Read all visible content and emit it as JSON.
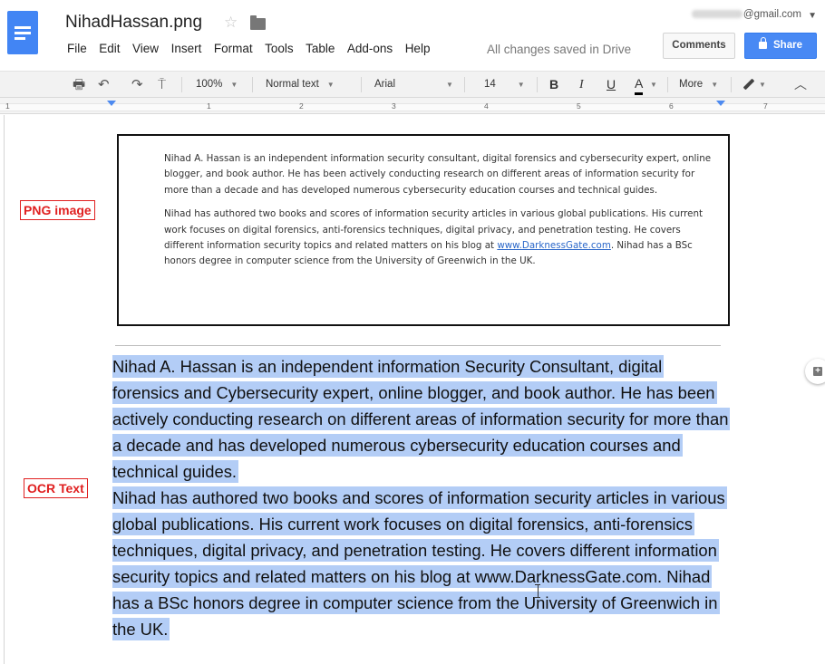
{
  "document": {
    "title": "NihadHassan.png",
    "account": "@gmail.com",
    "save_status": "All changes saved in Drive"
  },
  "menu": [
    "File",
    "Edit",
    "View",
    "Insert",
    "Format",
    "Tools",
    "Table",
    "Add-ons",
    "Help"
  ],
  "buttons": {
    "comments": "Comments",
    "share": "Share"
  },
  "toolbar": {
    "zoom": "100%",
    "style": "Normal text",
    "font": "Arial",
    "size": "14",
    "bold": "B",
    "italic": "I",
    "underline": "U",
    "text_color": "A",
    "more": "More"
  },
  "ruler": {
    "numbers": [
      "1",
      "1",
      "2",
      "3",
      "4",
      "5",
      "6",
      "7"
    ]
  },
  "labels": {
    "png": "PNG image",
    "ocr": "OCR Text"
  },
  "png_image": {
    "para1": "Nihad A. Hassan is an independent information security consultant, digital forensics and cybersecurity expert, online blogger, and book author. He has been actively conducting research on different areas of information security for more than a decade and has developed numerous cybersecurity education courses and technical guides.",
    "para2_before": "Nihad has authored two books and scores of information security articles in various global publications. His current work focuses on digital forensics, anti-forensics techniques, digital privacy, and penetration testing. He covers different information security topics and related matters on his blog at ",
    "para2_link": "www.DarknessGate.com",
    "para2_after": ". Nihad has a BSc honors degree in computer science from the University of Greenwich in the UK."
  },
  "ocr_text": {
    "para1": "Nihad A. Hassan is an independent information Security Consultant, digital forensics and Cybersecurity expert, online blogger, and book author. He has been actively conducting research on different areas of information security for more than a decade and has developed numerous cybersecurity education courses and technical guides.",
    "para2": "Nihad has authored two books and scores of information security articles in various global publications. His current work focuses on digital forensics, anti-forensics techniques, digital privacy, and penetration testing. He covers different information security topics and related matters on his blog at www.DarknessGate.com. Nihad has a BSc honors degree in computer science from the University of Greenwich in the UK."
  },
  "colors": {
    "brand_blue": "#4285f4",
    "share_button": "#4889f4",
    "selection": "#b3cdf6",
    "label_red": "#e02020",
    "link": "#2a67c9"
  },
  "icons": [
    "docs-logo-icon",
    "star-icon",
    "folder-icon",
    "lock-icon",
    "print-icon",
    "undo-icon",
    "redo-icon",
    "paint-format-icon",
    "pencil-icon",
    "collapse-icon",
    "add-comment-icon"
  ]
}
